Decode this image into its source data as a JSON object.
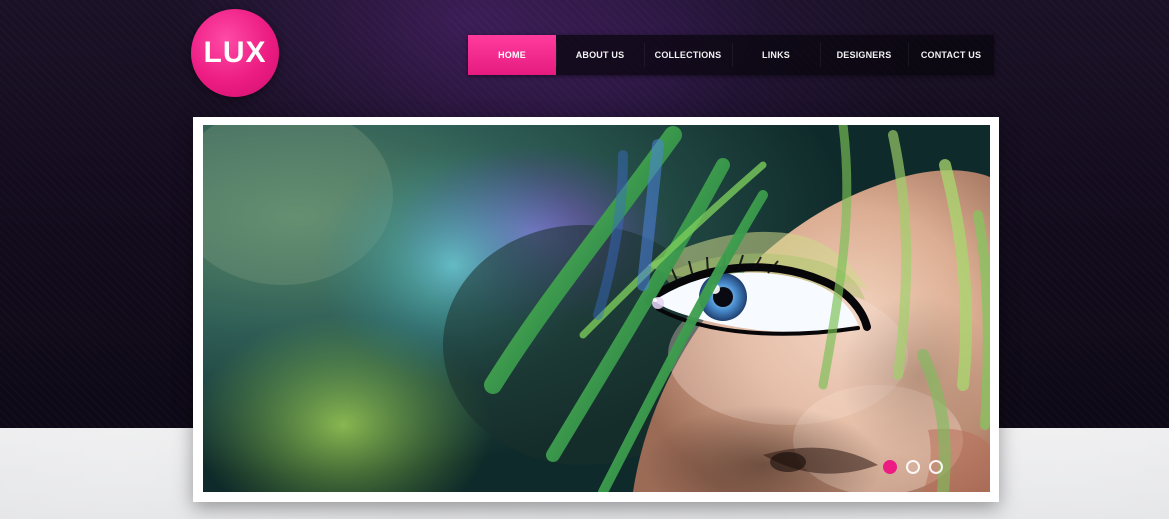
{
  "brand": {
    "logo_text": "LUX",
    "accent": "#ec1c82"
  },
  "nav": {
    "items": [
      {
        "label": "HOME",
        "active": true
      },
      {
        "label": "ABOUT US",
        "active": false
      },
      {
        "label": "COLLECTIONS",
        "active": false
      },
      {
        "label": "LINKS",
        "active": false
      },
      {
        "label": "DESIGNERS",
        "active": false
      },
      {
        "label": "CONTACT US",
        "active": false
      }
    ]
  },
  "slider": {
    "image": "fashion-model-closeup",
    "slide_count": 3,
    "current_slide": 1
  }
}
